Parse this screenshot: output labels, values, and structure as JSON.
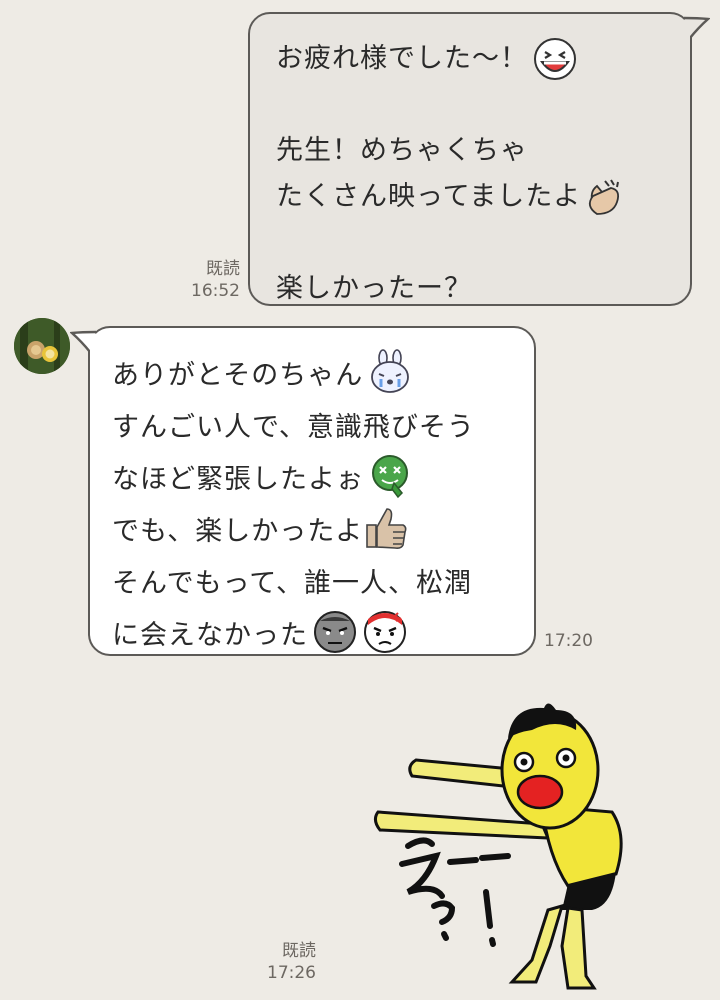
{
  "outgoing": {
    "lines": [
      "お疲れ様でした〜！",
      "",
      "先生！めちゃくちゃ",
      "たくさん映ってましたよ",
      "",
      "楽しかったー？"
    ],
    "read_label": "既読",
    "time": "16:52"
  },
  "incoming": {
    "lines": [
      "ありがとそのちゃん",
      "すんごい人で、意識飛びそう",
      "なほど緊張したよぉ",
      "でも、楽しかったよ",
      "そんでもって、誰一人、松潤",
      "に会えなかった"
    ],
    "time": "17:20"
  },
  "sticker": {
    "read_label": "既読",
    "time": "17:26",
    "text": "え〜〜！"
  },
  "emoji": {
    "laugh": "laughing-face",
    "clap": "clapping-hands",
    "rabbit": "crying-rabbit",
    "dizzy": "dizzy-green-face",
    "thumb": "thumbs-up",
    "glare_gray": "glaring-gray-face",
    "glare_red": "angry-red-face"
  },
  "colors": {
    "background": "#eeebe5",
    "outgoing_bubble": "#e8e5e0",
    "incoming_bubble": "#ffffff",
    "border": "#5c5a57",
    "meta_text": "#6d6862"
  }
}
